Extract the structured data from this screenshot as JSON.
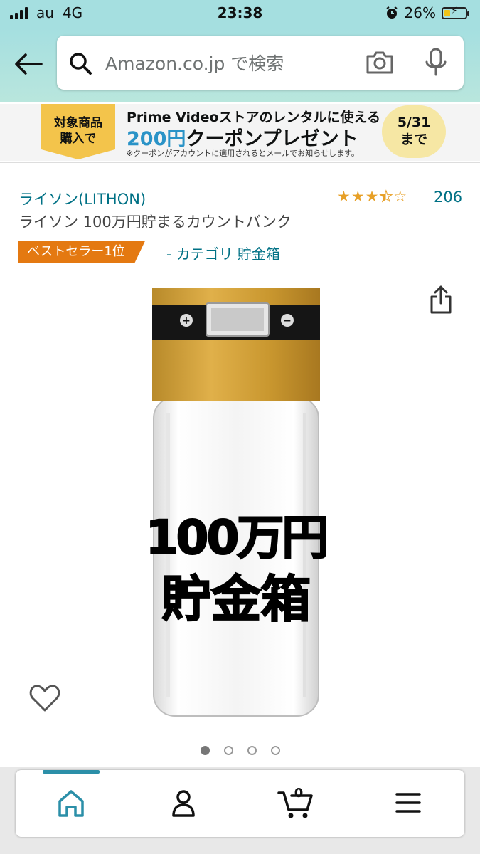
{
  "status_bar": {
    "carrier": "au",
    "network": "4G",
    "time": "23:38",
    "battery": "26%"
  },
  "search": {
    "placeholder": "Amazon.co.jp で検索"
  },
  "banner": {
    "tag_line1": "対象商品",
    "tag_line2": "購入で",
    "headline": "Prime Videoストアのレンタルに使える",
    "amount": "200円",
    "offer": "クーポンプレゼント",
    "note": "※クーポンがアカウントに適用されるとメールでお知らせします。",
    "date": "5/31",
    "date_suffix": "まで"
  },
  "product": {
    "brand": "ライソン(LITHON)",
    "title": "ライソン 100万円貯まるカウントバンク",
    "rating": 3.5,
    "review_count": "206",
    "bestseller_badge": "ベストセラー1位",
    "category": "- カテゴリ 貯金箱",
    "image_text_line1": "100万円",
    "image_text_line2": "貯金箱",
    "lcd_plus": "+",
    "lcd_minus": "−"
  },
  "carousel": {
    "total": 4,
    "active": 0
  },
  "colors": {
    "accent_teal": "#a5dfe0",
    "link": "#007185",
    "badge": "#e47911",
    "star": "#e7a027"
  },
  "tab_bar": {
    "items": [
      {
        "icon": "home-icon",
        "active": true
      },
      {
        "icon": "account-icon",
        "active": false
      },
      {
        "icon": "cart-icon",
        "active": false,
        "count": "0"
      },
      {
        "icon": "menu-icon",
        "active": false
      }
    ]
  }
}
